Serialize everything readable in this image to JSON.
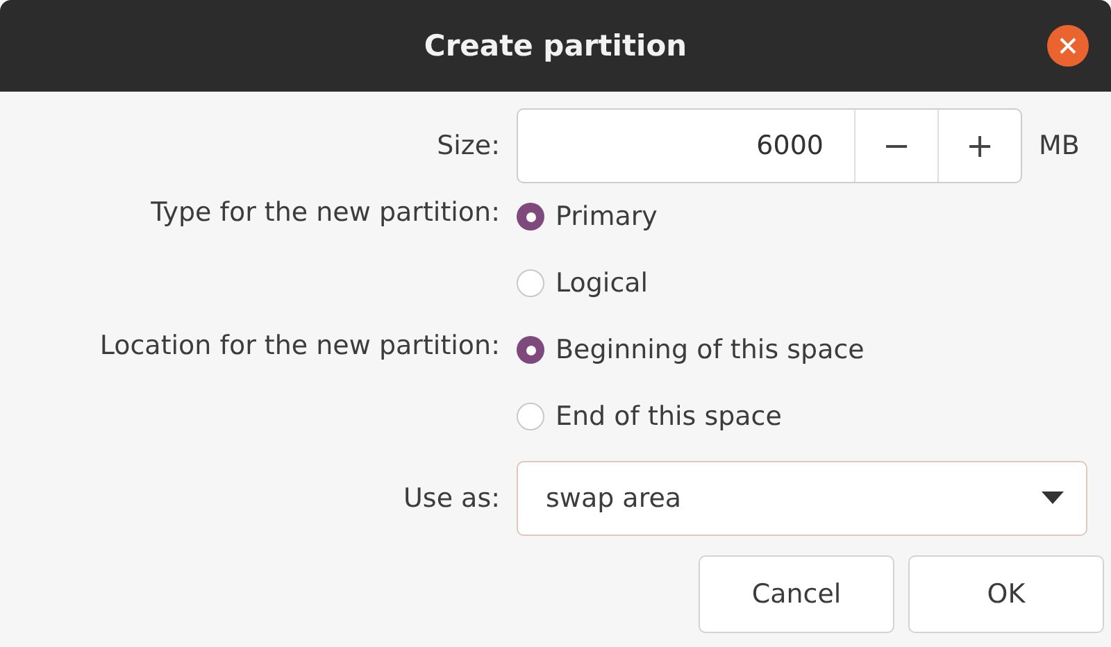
{
  "window": {
    "title": "Create partition"
  },
  "size": {
    "label": "Size:",
    "value": "6000",
    "decrement": "−",
    "increment": "+",
    "unit": "MB"
  },
  "type": {
    "label": "Type for the new partition:",
    "options": [
      {
        "label": "Primary",
        "selected": true
      },
      {
        "label": "Logical",
        "selected": false
      }
    ]
  },
  "location": {
    "label": "Location for the new partition:",
    "options": [
      {
        "label": "Beginning of this space",
        "selected": true
      },
      {
        "label": "End of this space",
        "selected": false
      }
    ]
  },
  "use_as": {
    "label": "Use as:",
    "value": "swap area"
  },
  "buttons": [
    "Cancel",
    "OK"
  ]
}
